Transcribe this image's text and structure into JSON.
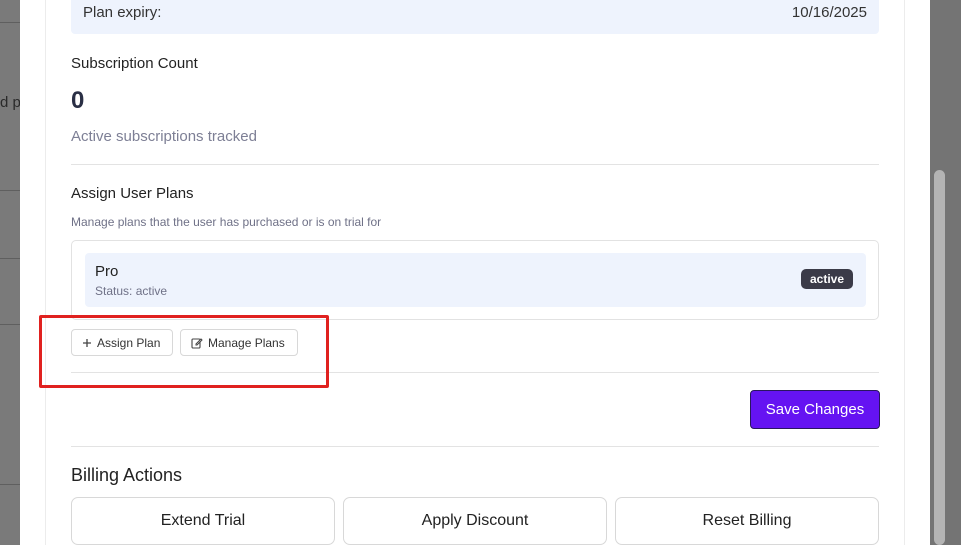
{
  "background": {
    "partial_text": "d p"
  },
  "plan_expiry": {
    "label": "Plan expiry:",
    "value": "10/16/2025"
  },
  "subscription": {
    "title": "Subscription Count",
    "count": "0",
    "caption": "Active subscriptions tracked"
  },
  "user_plans": {
    "title": "Assign User Plans",
    "description": "Manage plans that the user has purchased or is on trial for",
    "plans": [
      {
        "name": "Pro",
        "status": "Status: active",
        "badge": "active"
      }
    ],
    "assign_label": "Assign Plan",
    "manage_label": "Manage Plans",
    "assign_icon": "plus-icon",
    "manage_icon": "edit-icon"
  },
  "save_label": "Save Changes",
  "billing": {
    "title": "Billing Actions",
    "actions": [
      "Extend Trial",
      "Apply Discount",
      "Reset Billing"
    ]
  },
  "colors": {
    "accent": "#6513f2",
    "highlight": "#e0211f",
    "badge_bg": "#3b3b48",
    "row_bg": "#eef3fd"
  }
}
